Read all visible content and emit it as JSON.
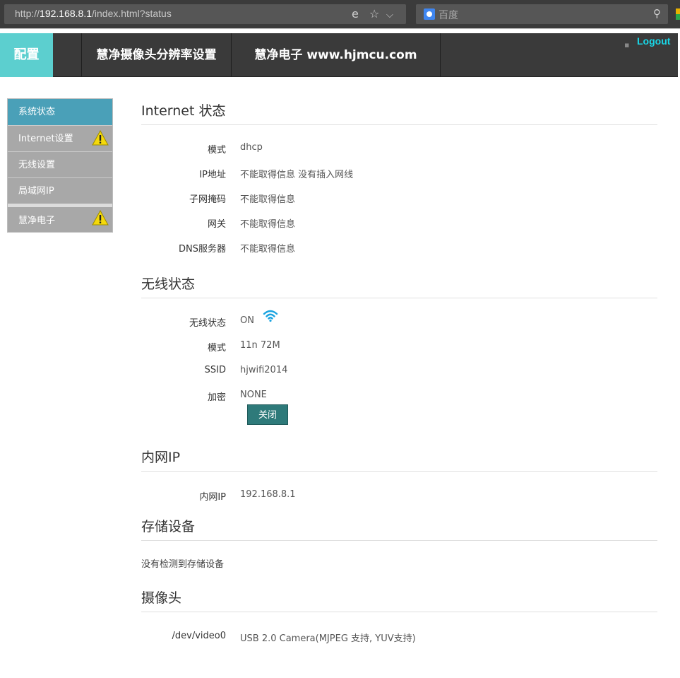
{
  "browser": {
    "url_prefix": "http://",
    "url_host": "192.168.8.1",
    "url_path": "/index.html?status",
    "search_placeholder": "百度"
  },
  "header": {
    "brand": "配置",
    "nav": [
      "慧净摄像头分辨率设置",
      "慧净电子 www.hjmcu.com"
    ],
    "logout": "Logout"
  },
  "sidebar": {
    "items": [
      {
        "label": "系统状态",
        "active": true,
        "warning": false
      },
      {
        "label": "Internet设置",
        "active": false,
        "warning": true
      },
      {
        "label": "无线设置",
        "active": false,
        "warning": false
      },
      {
        "label": "局域网IP",
        "active": false,
        "warning": false
      },
      {
        "label": "慧净电子",
        "active": false,
        "warning": true
      }
    ]
  },
  "internet": {
    "title": "Internet 状态",
    "rows": [
      {
        "label": "模式",
        "value": "dhcp"
      },
      {
        "label": "IP地址",
        "value": "不能取得信息 没有插入网线"
      },
      {
        "label": "子网掩码",
        "value": "不能取得信息"
      },
      {
        "label": "网关",
        "value": "不能取得信息"
      },
      {
        "label": "DNS服务器",
        "value": "不能取得信息"
      }
    ]
  },
  "wireless": {
    "title": "无线状态",
    "rows": [
      {
        "label": "无线状态",
        "value": "ON"
      },
      {
        "label": "模式",
        "value": "11n 72M"
      },
      {
        "label": "SSID",
        "value": "hjwifi2014"
      },
      {
        "label": "加密",
        "value": "NONE"
      }
    ],
    "close_button": "关闭"
  },
  "lan": {
    "title": "内网IP",
    "rows": [
      {
        "label": "内网IP",
        "value": "192.168.8.1"
      }
    ]
  },
  "storage": {
    "title": "存储设备",
    "note": "没有检测到存储设备"
  },
  "camera": {
    "title": "摄像头",
    "rows": [
      {
        "label": "/dev/video0",
        "value": "USB 2.0 Camera(MJPEG 支持, YUV支持)"
      }
    ]
  },
  "colors": {
    "brand_bg": "#5ccfcf",
    "header_bg": "#3a3a3a",
    "active_item": "#4aa0b8",
    "button_bg": "#2e7a7a",
    "logout": "#19d6e6"
  }
}
